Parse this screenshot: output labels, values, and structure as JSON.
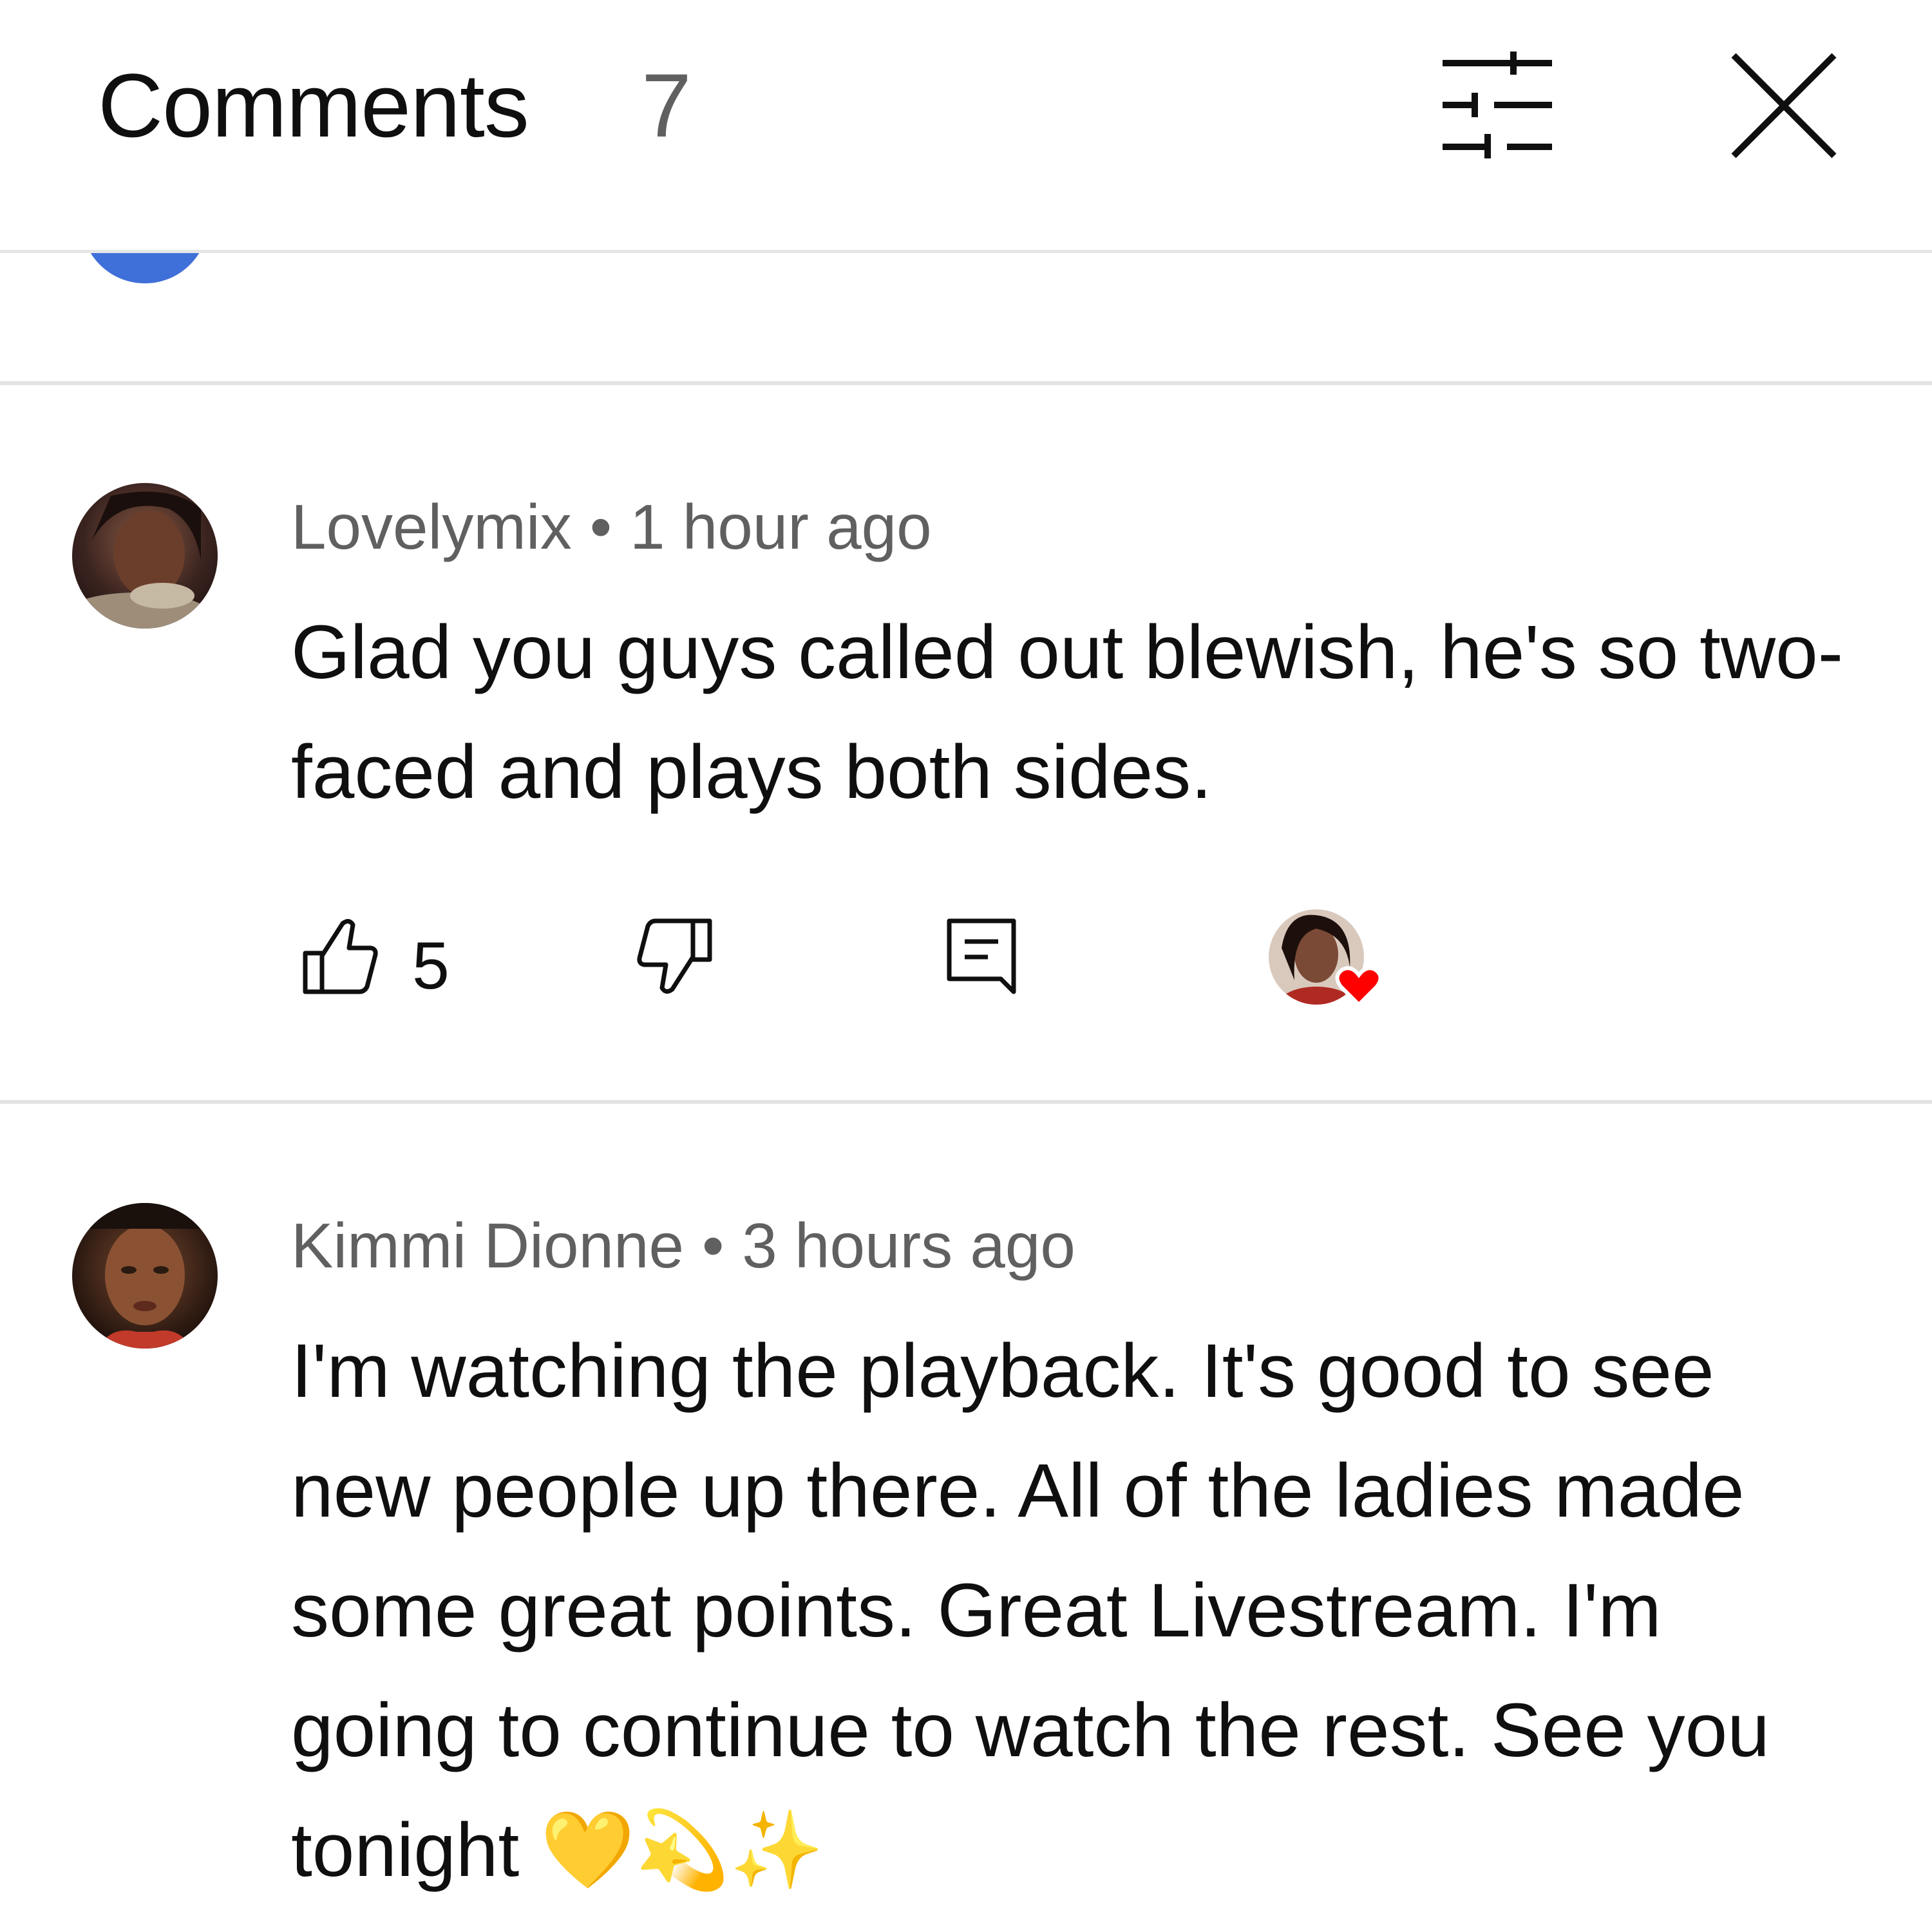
{
  "header": {
    "title": "Comments",
    "count": "7"
  },
  "icons": {
    "filter": "sliders-icon",
    "close": "close-icon",
    "like": "thumbs-up-icon",
    "dislike": "thumbs-down-icon",
    "reply": "reply-comment-icon",
    "creator_heart": "creator-heart-icon"
  },
  "comments": [
    {
      "author": "Lovelymix",
      "separator": "•",
      "time": "1 hour ago",
      "text": "Glad you guys called out blewish, he's so two-faced and plays both sides.",
      "likes": "5"
    },
    {
      "author": "Kimmi Dionne",
      "separator": "•",
      "time": "3 hours ago",
      "text": "I'm watching the playback. It's good to see new people up there. All of the ladies made some great points. Great Livestream. I'm going to continue to watch the rest. See you tonight 💛💫✨"
    }
  ],
  "colors": {
    "text_primary": "#0f0f0f",
    "text_secondary": "#606060",
    "divider": "#e3e3e3",
    "heart": "#ff0000"
  }
}
